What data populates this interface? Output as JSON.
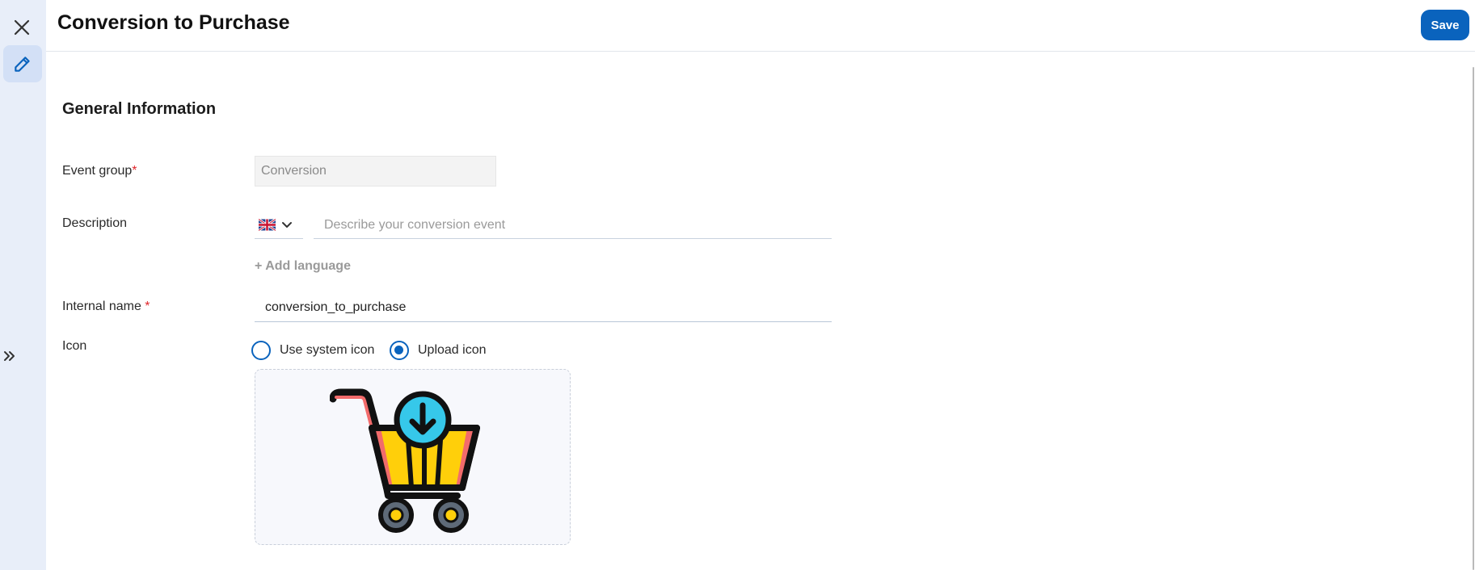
{
  "header": {
    "title": "Conversion to Purchase",
    "save_label": "Save"
  },
  "rail": {
    "close_icon": "close-icon",
    "edit_icon": "pencil-icon",
    "expand_icon": "double-chevron-right-icon"
  },
  "section": {
    "title": "General Information"
  },
  "form": {
    "event_group": {
      "label": "Event group",
      "required_mark": "*",
      "value": "Conversion"
    },
    "description": {
      "label": "Description",
      "language_flag": "uk-flag-icon",
      "placeholder": "Describe your conversion event",
      "value": ""
    },
    "add_language_label": "+ Add language",
    "internal_name": {
      "label": "Internal name",
      "required_mark": "*",
      "value": "conversion_to_purchase"
    },
    "icon": {
      "label": "Icon",
      "options": [
        {
          "label": "Use system icon",
          "selected": false
        },
        {
          "label": "Upload icon",
          "selected": true
        }
      ],
      "uploaded_icon": "shopping-cart-download-icon"
    }
  },
  "colors": {
    "primary": "#0a63bd",
    "rail_bg": "#e8eef9",
    "required": "#e0262b"
  }
}
